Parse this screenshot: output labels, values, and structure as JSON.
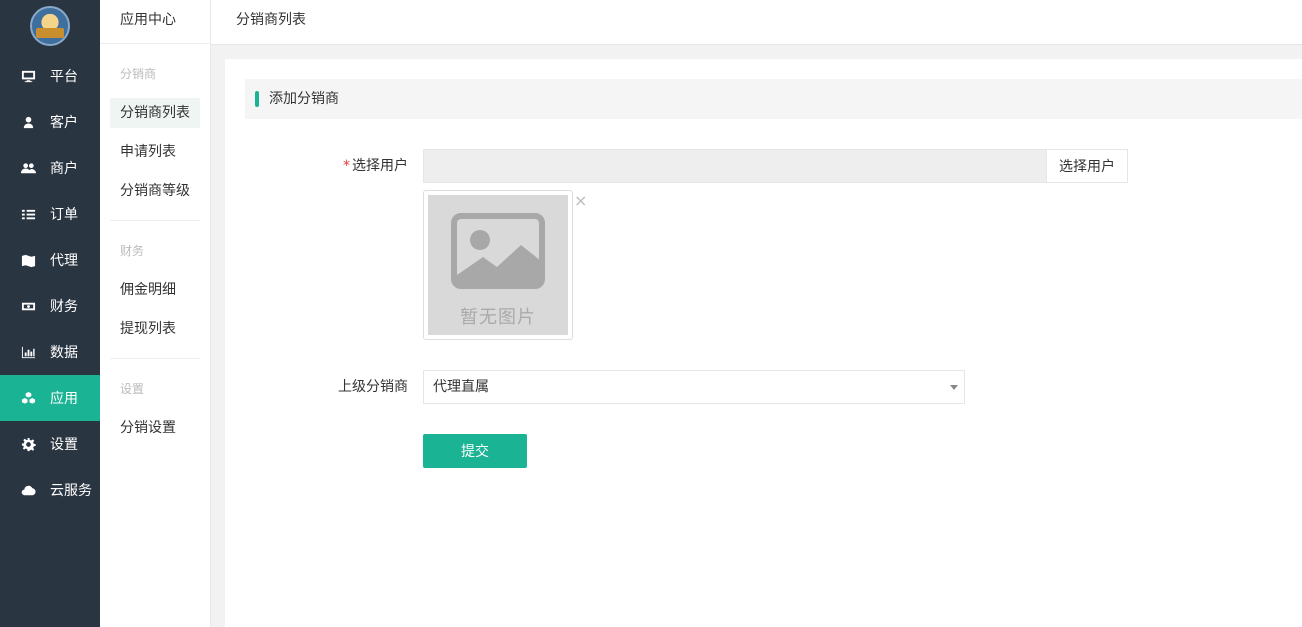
{
  "nav": {
    "items": [
      {
        "label": "平台",
        "icon": "monitor-icon"
      },
      {
        "label": "客户",
        "icon": "user-icon"
      },
      {
        "label": "商户",
        "icon": "users-icon"
      },
      {
        "label": "订单",
        "icon": "list-icon"
      },
      {
        "label": "代理",
        "icon": "map-icon"
      },
      {
        "label": "财务",
        "icon": "money-icon"
      },
      {
        "label": "数据",
        "icon": "bar-chart-icon"
      },
      {
        "label": "应用",
        "icon": "cubes-icon",
        "active": true
      },
      {
        "label": "设置",
        "icon": "gear-icon"
      },
      {
        "label": "云服务",
        "icon": "cloud-icon"
      }
    ]
  },
  "sidebar": {
    "title": "应用中心",
    "groups": [
      {
        "title": "分销商",
        "items": [
          "分销商列表",
          "申请列表",
          "分销商等级"
        ]
      },
      {
        "title": "财务",
        "items": [
          "佣金明细",
          "提现列表"
        ]
      },
      {
        "title": "设置",
        "items": [
          "分销设置"
        ]
      }
    ],
    "active_item": "分销商列表"
  },
  "topbar": {
    "breadcrumb": "分销商列表"
  },
  "form": {
    "section_title": "添加分销商",
    "required_mark": "*",
    "user_label": "选择用户",
    "user_value": "",
    "user_button": "选择用户",
    "image_placeholder": "暂无图片",
    "close_symbol": "×",
    "parent_label": "上级分销商",
    "parent_value": "代理直属",
    "submit_label": "提交"
  },
  "colors": {
    "accent": "#1ab394",
    "nav_bg": "#2a3542"
  }
}
